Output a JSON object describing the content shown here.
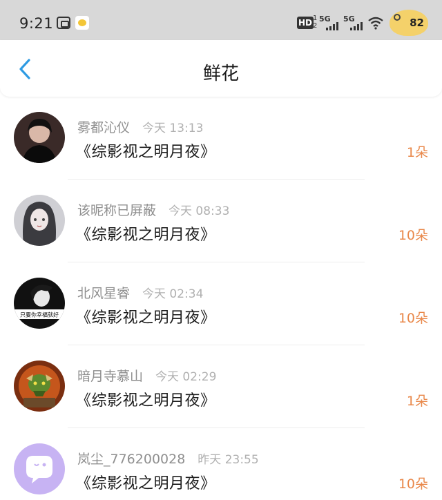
{
  "status_bar": {
    "time": "9:21",
    "hd_label": "HD",
    "hd_sub": "1\n2",
    "network_1": "5G",
    "network_2": "5G",
    "battery": "82"
  },
  "header": {
    "title": "鲜花",
    "back_icon": "chevron-left-icon",
    "accent_color": "#2f9be3"
  },
  "flower_records": [
    {
      "sender": "雾都沁仪",
      "time": "今天 13:13",
      "book": "《综影视之明月夜》",
      "quantity": "1朵"
    },
    {
      "sender": "该昵称已屏蔽",
      "time": "今天 08:33",
      "book": "《综影视之明月夜》",
      "quantity": "10朵"
    },
    {
      "sender": "北风星睿",
      "time": "今天 02:34",
      "book": "《综影视之明月夜》",
      "quantity": "10朵"
    },
    {
      "sender": "暗月寺慕山",
      "time": "今天 02:29",
      "book": "《综影视之明月夜》",
      "quantity": "1朵"
    },
    {
      "sender": "岚尘_776200028",
      "time": "昨天 23:55",
      "book": "《综影视之明月夜》",
      "quantity": "10朵"
    }
  ],
  "avatar_captions": {
    "item_3": "只要你幸福就好"
  },
  "colors": {
    "quantity": "#e9884a",
    "status_bar_bg": "#d8d8d8"
  }
}
